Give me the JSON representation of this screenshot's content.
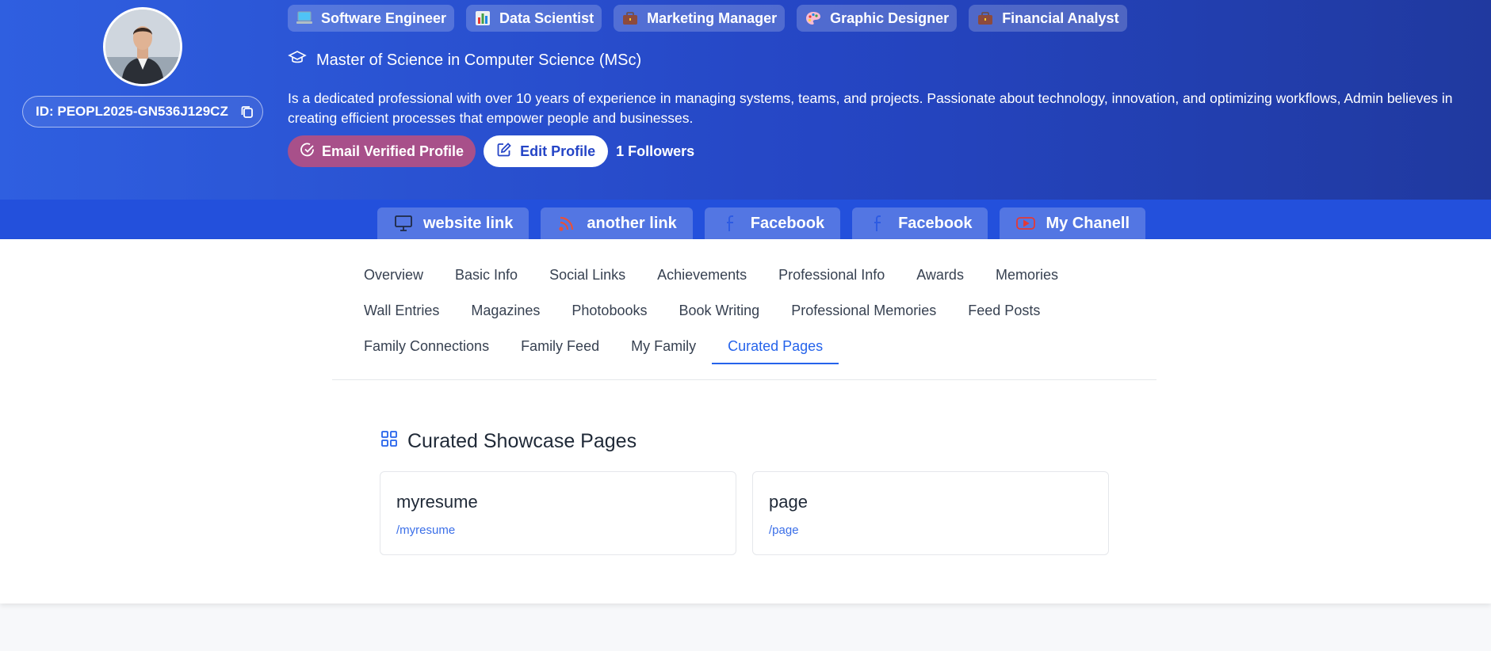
{
  "profile": {
    "id_label": "ID: PEOPL2025-GN536J129CZ",
    "professions": [
      {
        "label": "Software Engineer",
        "icon": "laptop-icon"
      },
      {
        "label": "Data Scientist",
        "icon": "bar-chart-icon"
      },
      {
        "label": "Marketing Manager",
        "icon": "briefcase-icon"
      },
      {
        "label": "Graphic Designer",
        "icon": "palette-icon"
      },
      {
        "label": "Financial Analyst",
        "icon": "briefcase-icon"
      }
    ],
    "degree": "Master of Science in Computer Science (MSc)",
    "bio": "Is a dedicated professional with over 10 years of experience in managing systems, teams, and projects. Passionate about technology, innovation, and optimizing workflows, Admin believes in creating efficient processes that empower people and businesses.",
    "verified_label": "Email Verified Profile",
    "edit_label": "Edit Profile",
    "followers": "1 Followers"
  },
  "links": [
    {
      "label": "website link",
      "icon": "monitor-icon"
    },
    {
      "label": "another link",
      "icon": "rss-icon"
    },
    {
      "label": "Facebook",
      "icon": "facebook-icon"
    },
    {
      "label": "Facebook",
      "icon": "facebook-icon"
    },
    {
      "label": "My Chanell",
      "icon": "youtube-icon"
    }
  ],
  "tabs": [
    [
      "Overview",
      "Basic Info",
      "Social Links",
      "Achievements",
      "Professional Info",
      "Awards",
      "Memories"
    ],
    [
      "Wall Entries",
      "Magazines",
      "Photobooks",
      "Book Writing",
      "Professional Memories",
      "Feed Posts"
    ],
    [
      "Family Connections",
      "Family Feed",
      "My Family",
      "Curated Pages"
    ]
  ],
  "active_tab": "Curated Pages",
  "section": {
    "title": "Curated Showcase Pages",
    "pages": [
      {
        "title": "myresume",
        "slug": "/myresume"
      },
      {
        "title": "page",
        "slug": "/page"
      }
    ]
  },
  "colors": {
    "hero_start": "#2f5fe0",
    "hero_end": "#20399f",
    "accent": "#2563eb",
    "verified": "#a8508a"
  }
}
